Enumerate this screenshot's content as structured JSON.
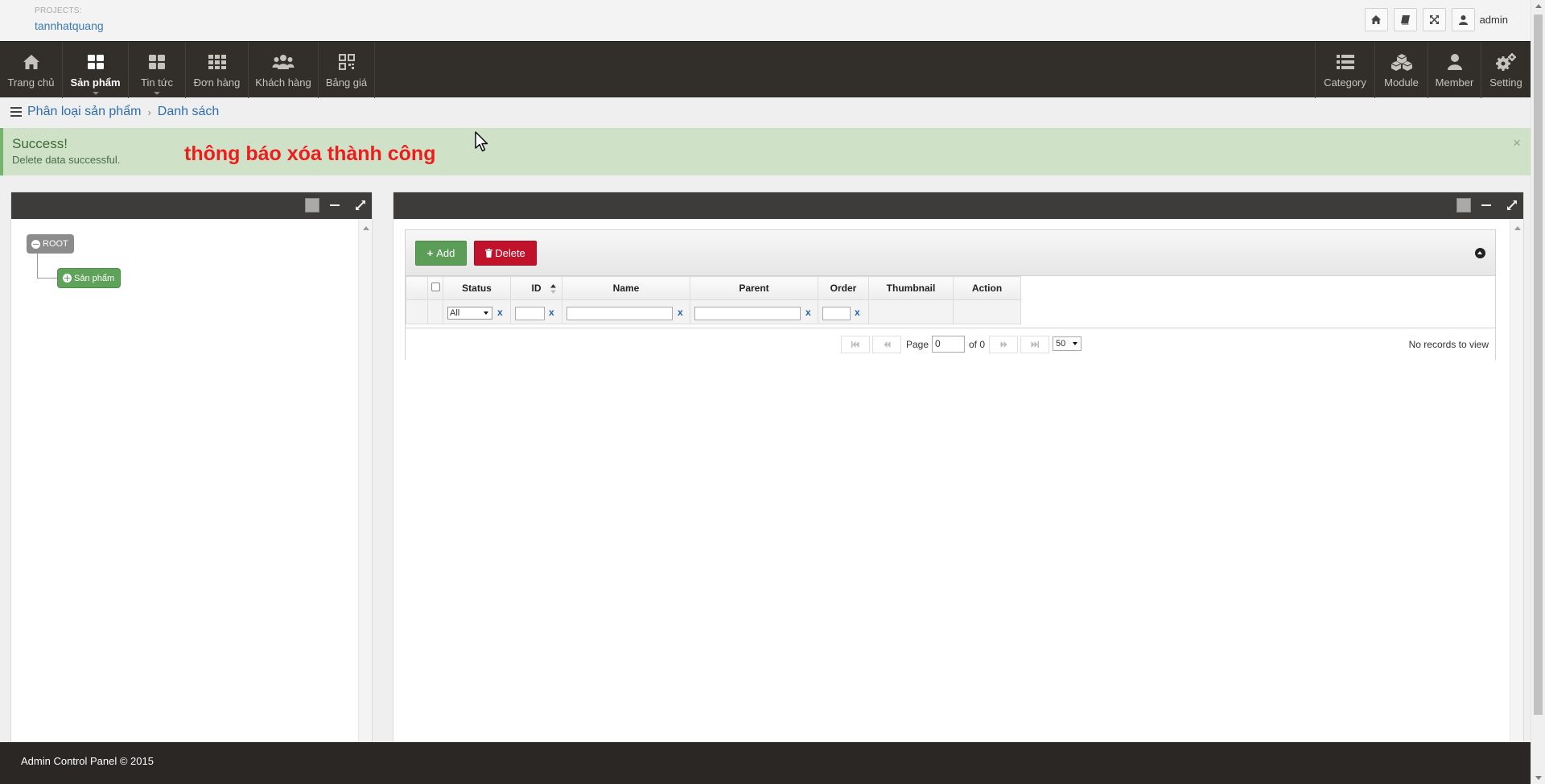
{
  "header": {
    "projects_label": "PROJECTS:",
    "project_name": "tannhatquang",
    "user_name": "admin"
  },
  "nav": {
    "left": [
      {
        "label": "Trang chủ",
        "icon": "home-icon"
      },
      {
        "label": "Sản phẩm",
        "icon": "grid-large-icon",
        "active": true
      },
      {
        "label": "Tin tức",
        "icon": "grid-large-icon"
      },
      {
        "label": "Đơn hàng",
        "icon": "grid-small-icon"
      },
      {
        "label": "Khách hàng",
        "icon": "users-icon"
      },
      {
        "label": "Bảng giá",
        "icon": "qrcode-icon"
      }
    ],
    "right": [
      {
        "label": "Category",
        "icon": "list-icon"
      },
      {
        "label": "Module",
        "icon": "cubes-icon"
      },
      {
        "label": "Member",
        "icon": "user-icon"
      },
      {
        "label": "Setting",
        "icon": "gears-icon"
      }
    ]
  },
  "breadcrumb": {
    "items": [
      "Phân loại sản phẩm",
      "Danh sách"
    ]
  },
  "alert": {
    "title": "Success!",
    "message": "Delete data successful.",
    "annotation": "thông báo xóa thành công",
    "close": "×"
  },
  "tree": {
    "root": "ROOT",
    "child": "Sản phẩm"
  },
  "grid": {
    "add_label": "Add",
    "delete_label": "Delete",
    "columns": [
      "Status",
      "ID",
      "Name",
      "Parent",
      "Order",
      "Thumbnail",
      "Action"
    ],
    "status_filter": "All",
    "clear": "x",
    "pager": {
      "page_label": "Page",
      "page_value": "0",
      "of_label": "of 0",
      "page_size": "50",
      "empty_text": "No records to view"
    }
  },
  "footer": {
    "text": "Admin Control Panel © 2015"
  },
  "colors": {
    "nav_bg": "#322e2a",
    "alert_bg": "#cfe2c8",
    "add_button": "#5c9d57",
    "delete_button": "#c1122c",
    "annotation": "#ee1c1c"
  }
}
